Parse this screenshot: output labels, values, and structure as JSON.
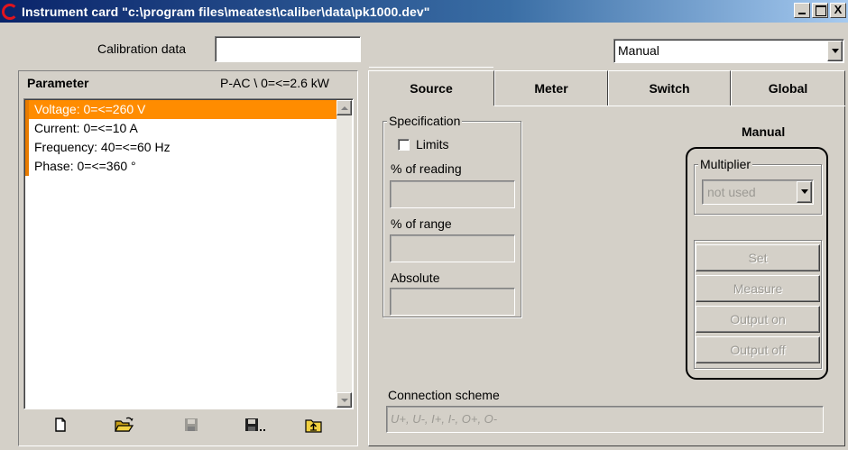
{
  "window": {
    "title": "Instrument card \"c:\\program files\\meatest\\caliber\\data\\pk1000.dev\"",
    "close_glyph": "X"
  },
  "calibration": {
    "label": "Calibration data",
    "value": ""
  },
  "mode_select": {
    "value": "Manual"
  },
  "parameter_panel": {
    "header_label": "Parameter",
    "header_range": "P-AC \\ 0=<=2.6 kW",
    "items": [
      "Voltage: 0=<=260 V",
      "Current: 0=<=10 A",
      "Frequency: 40=<=60 Hz",
      "Phase: 0=<=360 °"
    ],
    "selected_index": 0,
    "accent_color": "#ff8c00"
  },
  "toolbar": {
    "icons": [
      "new-file-icon",
      "open-folder-icon",
      "save-icon",
      "save-as-icon",
      "export-icon"
    ]
  },
  "tabs": [
    "Source",
    "Meter",
    "Switch",
    "Global"
  ],
  "active_tab": "Source",
  "specification": {
    "title": "Specification",
    "limits_label": "Limits",
    "limits_checked": false,
    "percent_reading_label": "% of reading",
    "percent_reading_value": "",
    "percent_range_label": "% of range",
    "percent_range_value": "",
    "absolute_label": "Absolute",
    "absolute_value": ""
  },
  "manual": {
    "title": "Manual",
    "multiplier_title": "Multiplier",
    "multiplier_value": "not used",
    "buttons": [
      "Set",
      "Measure",
      "Output on",
      "Output off"
    ]
  },
  "connection": {
    "label": "Connection scheme",
    "value": "U+, U-, I+, I-, O+, O-"
  }
}
